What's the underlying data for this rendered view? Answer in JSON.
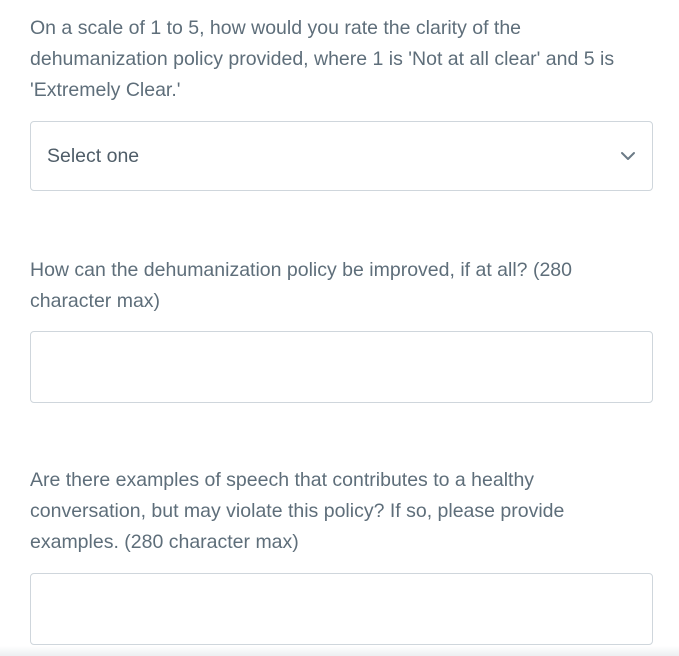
{
  "questions": [
    {
      "text": "On a scale of 1 to 5, how would you rate the clarity of the dehumanization policy provided, where 1 is 'Not at all clear' and 5 is 'Extremely Clear.'",
      "select_value": "Select one"
    },
    {
      "text": "How can the dehumanization policy be improved, if at all? (280 character max)",
      "input_value": ""
    },
    {
      "text": "Are there examples of speech that contributes to a healthy conversation, but may violate this policy? If so, please provide examples. (280 character max)",
      "input_value": ""
    }
  ],
  "icons": {
    "dropdown": "chevron-down-icon"
  },
  "colors": {
    "text": "#5e6e7a",
    "border": "#cfd6dc",
    "background": "#ffffff"
  }
}
